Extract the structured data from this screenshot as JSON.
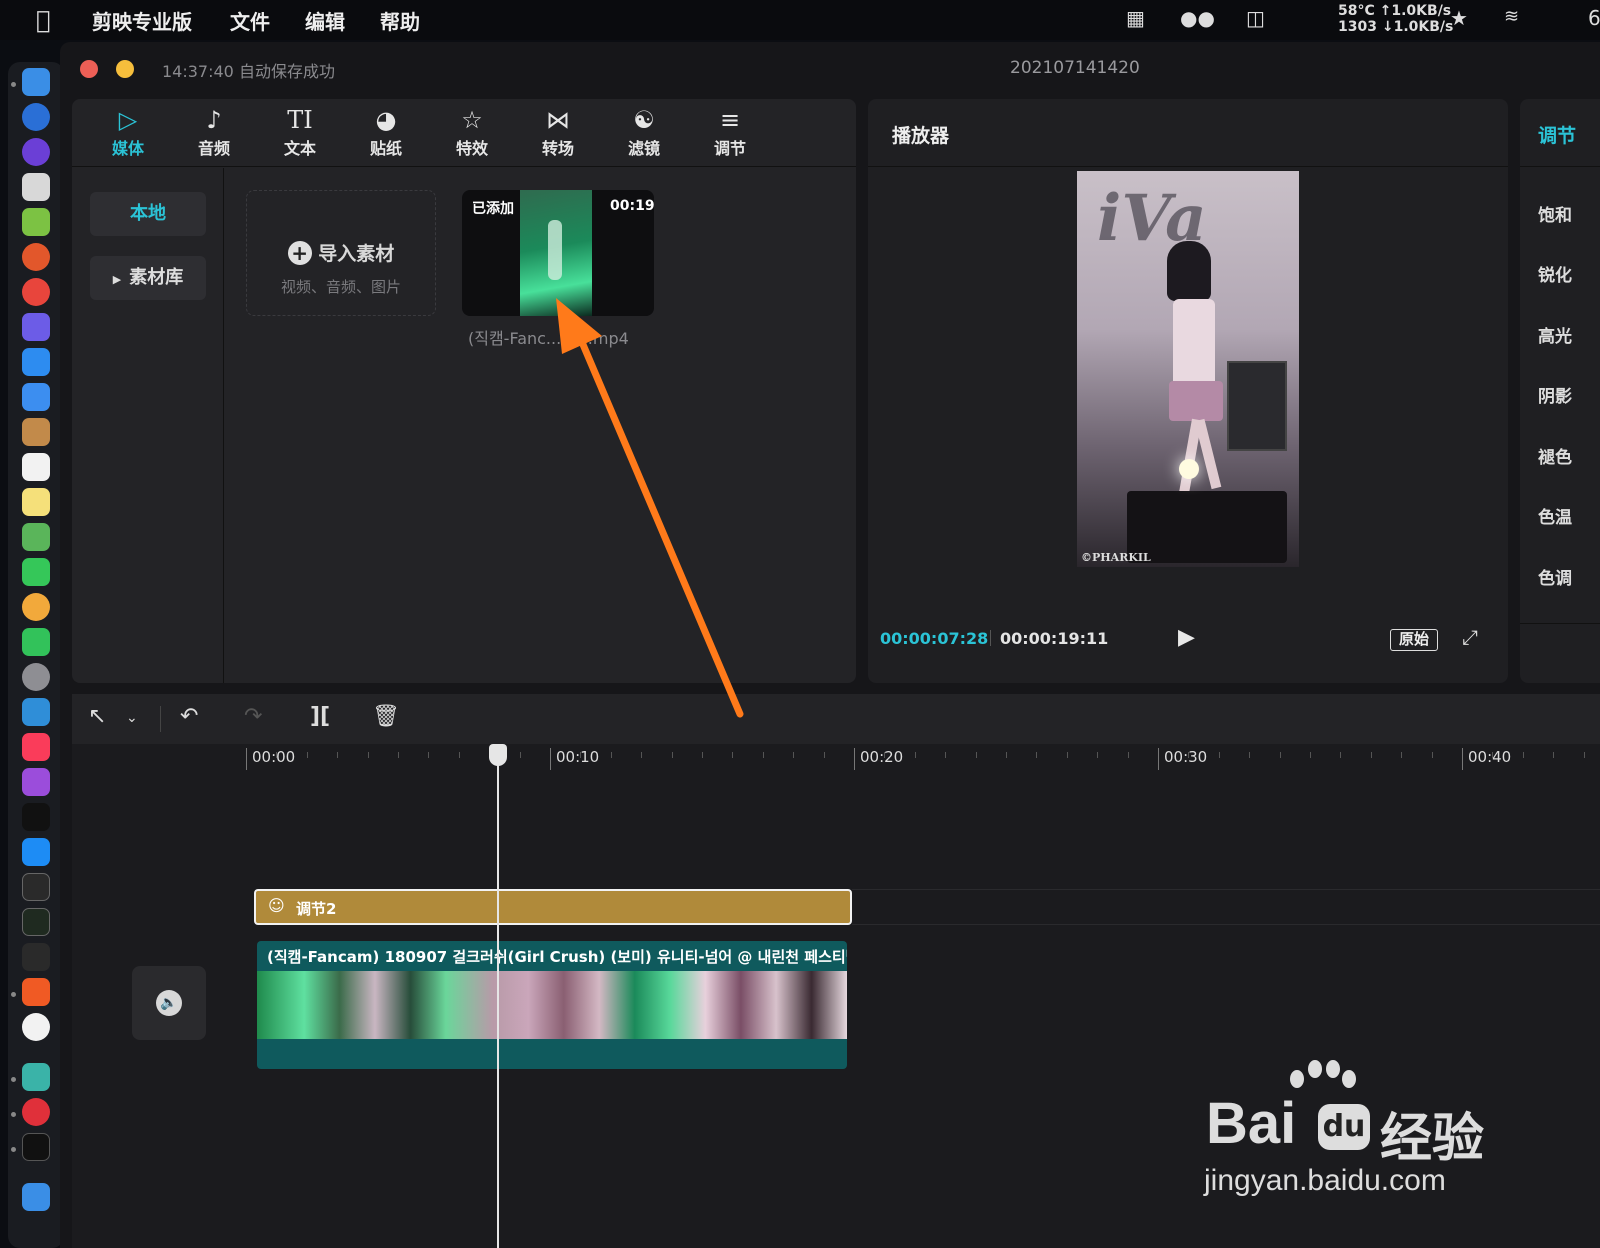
{
  "menubar": {
    "app_name": "剪映专业版",
    "items": [
      "文件",
      "编辑",
      "帮助"
    ],
    "temp": "58°C",
    "fan": "1303",
    "net_up": "↑1.0KB/s",
    "net_down": "↓1.0KB/s",
    "battery_partial": "6"
  },
  "window": {
    "save_status": "14:37:40 自动保存成功",
    "project_name": "202107141420"
  },
  "media_tabs": [
    {
      "label": "媒体",
      "icon": "media-icon",
      "active": true
    },
    {
      "label": "音频",
      "icon": "audio-icon"
    },
    {
      "label": "文本",
      "icon": "text-icon"
    },
    {
      "label": "贴纸",
      "icon": "sticker-icon"
    },
    {
      "label": "特效",
      "icon": "effects-icon"
    },
    {
      "label": "转场",
      "icon": "transition-icon"
    },
    {
      "label": "滤镜",
      "icon": "filter-icon"
    },
    {
      "label": "调节",
      "icon": "adjust-icon"
    }
  ],
  "media_side": {
    "local": "本地",
    "library": "素材库"
  },
  "import_box": {
    "title": "导入素材",
    "subtitle": "视频、音频、图片"
  },
  "clip": {
    "badge": "已添加",
    "duration": "00:19",
    "filename": "(직캠-Fanc...00].mp4"
  },
  "player": {
    "title": "播放器",
    "current_time": "00:00:07:28",
    "total_time": "00:00:19:11",
    "ratio_label": "原始",
    "preview_watermark": "©PHARKIL"
  },
  "adjust_panel": {
    "tab_partial": "调节",
    "items": [
      "饱和",
      "锐化",
      "高光",
      "阴影",
      "褪色",
      "色温",
      "色调"
    ]
  },
  "timeline": {
    "ruler": [
      "00:00",
      "00:10",
      "00:20",
      "00:30",
      "00:40"
    ],
    "adjust_clip_label": "调节2",
    "video_clip_title": "(직캠-Fancam) 180907 걸크러쉬(Girl Crush) (보미) 유니티-넘어 @ 내린천 페스티벌("
  },
  "watermark": {
    "brand": "Bai",
    "brand_cn": "经验",
    "url": "jingyan.baidu.com"
  },
  "colors": {
    "accent": "#2bc3d6",
    "adjust_clip": "#b08a3a",
    "video_clip": "#0f5a5d",
    "arrow": "#ff7a1a"
  }
}
